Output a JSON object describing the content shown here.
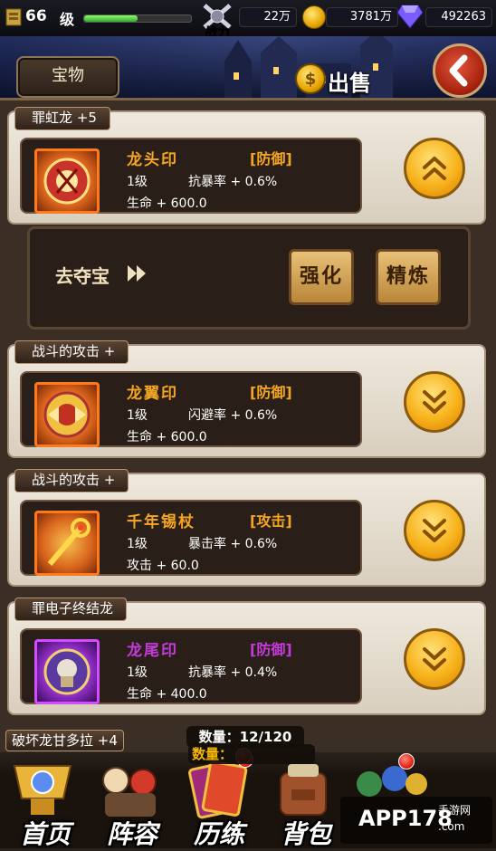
{
  "top_bar": {
    "level": "66",
    "level_label": "级",
    "xp_fraction": 0.5,
    "power_label": "战力",
    "power_value": "22万",
    "gold_value": "3781万",
    "gem_value": "492263"
  },
  "header": {
    "tab_label": "宝物",
    "sell_label": "出售",
    "sell_coin_glyph": "$"
  },
  "cards": [
    {
      "owner": "罪虹龙 +5",
      "name": "龙头印",
      "type": "[防御]",
      "level": "1级",
      "stat_a": "抗暴率 + 0.6%",
      "stat_b": "生命 + 600.0",
      "rarity_color": "#f5a623",
      "expanded": true
    },
    {
      "owner": "战斗的攻击 +",
      "name": "龙翼印",
      "type": "[防御]",
      "level": "1级",
      "stat_a": "闪避率 + 0.6%",
      "stat_b": "生命 + 600.0",
      "rarity_color": "#f5a623",
      "expanded": false
    },
    {
      "owner": "战斗的攻击 +",
      "name": "千年锡杖",
      "type": "[攻击]",
      "level": "1级",
      "stat_a": "暴击率 + 0.6%",
      "stat_b": "攻击 + 60.0",
      "rarity_color": "#f5a623",
      "expanded": false
    },
    {
      "owner": "罪电子终结龙",
      "name": "龙尾印",
      "type": "[防御]",
      "level": "1级",
      "stat_a": "抗暴率 + 0.4%",
      "stat_b": "生命 + 400.0",
      "rarity_color": "#c43bd9",
      "expanded": false
    }
  ],
  "action_panel": {
    "loot_label": "去夺宝",
    "enhance_label": "强化",
    "refine_label": "精炼"
  },
  "partial_card_owner": "破坏龙甘多拉 +4",
  "inventory": {
    "count_text": "数量：12/120",
    "count_text_2": "数量："
  },
  "bottom_nav": {
    "home": "首页",
    "lineup": "阵容",
    "training": "历练",
    "bag": "背包"
  },
  "watermark": {
    "text": "APP178",
    "sub": "手游网",
    "domain": ".com"
  }
}
